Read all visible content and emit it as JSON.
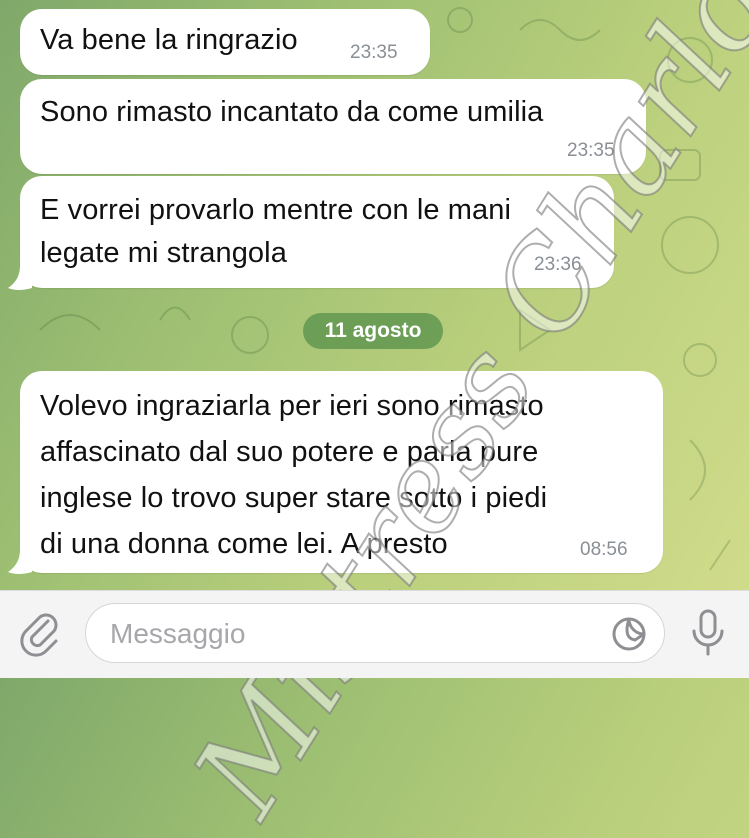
{
  "messages": [
    {
      "text": "Va bene la ringrazio",
      "time": "23:35"
    },
    {
      "text": "Sono rimasto incantato da come umilia",
      "time": "23:35"
    },
    {
      "text": "E vorrei provarlo mentre con le mani\nlegate mi strangola",
      "time": "23:36"
    },
    {
      "text": "Volevo  ingraziarla per ieri sono rimasto\naffascinato dal suo potere e parla pure\ninglese lo trovo super stare sotto i piedi\ndi una donna come lei. A presto",
      "time": "08:56"
    }
  ],
  "date_separator": "11 agosto",
  "input": {
    "placeholder": "Messaggio"
  },
  "icons": {
    "attach": "paperclip-icon",
    "sticker": "sticker-icon",
    "voice": "microphone-icon"
  },
  "watermark": "Mistress Charlotte",
  "colors": {
    "bubble": "#ffffff",
    "date_pill": "#6a9a55",
    "time_text": "#8a8f95",
    "background_start": "#7fa86a",
    "background_end": "#d3dd8c"
  }
}
